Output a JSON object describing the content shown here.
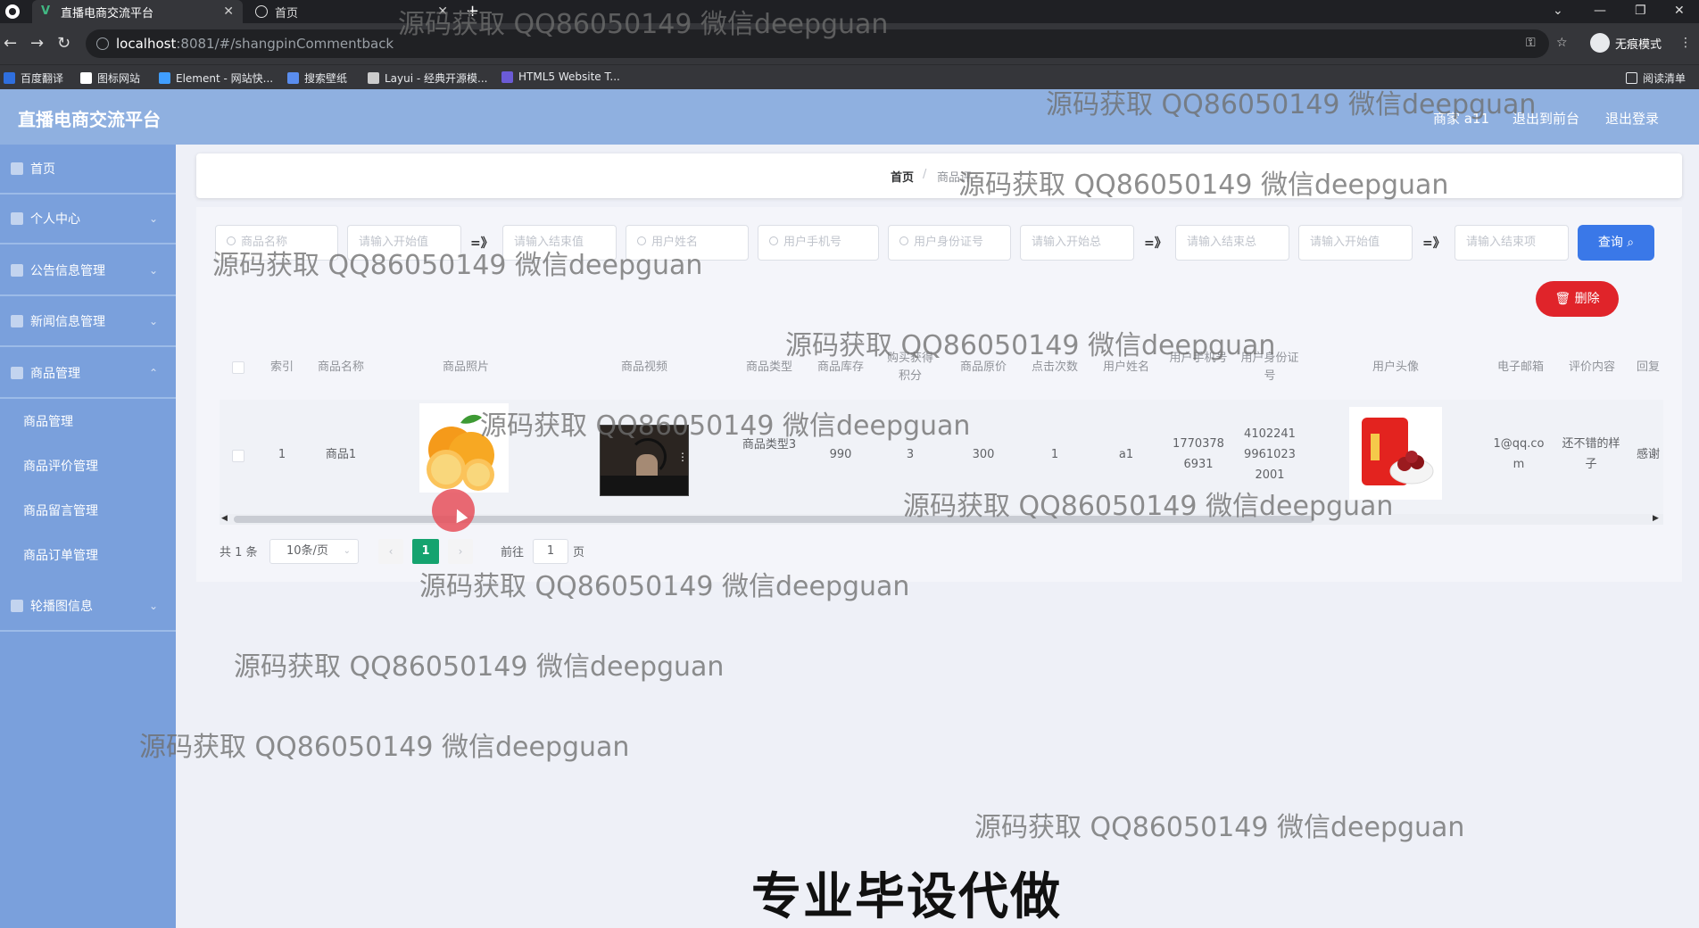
{
  "browser": {
    "tabs": [
      {
        "title": "直播电商交流平台",
        "active": true
      },
      {
        "title": "首页",
        "active": false
      }
    ],
    "url_host": "localhost",
    "url_path": ":8081/#/shangpinCommentback",
    "incognito_label": "无痕模式",
    "bookmarks": [
      "百度翻译",
      "图标网站",
      "Element - 网站快...",
      "搜索壁纸",
      "Layui - 经典开源模...",
      "HTML5 Website T..."
    ],
    "reading_list": "阅读清单"
  },
  "header": {
    "title": "直播电商交流平台",
    "user": "商家 a11",
    "back_front": "退出到前台",
    "logout": "退出登录"
  },
  "sidebar": {
    "items": [
      {
        "label": "首页"
      },
      {
        "label": "个人中心"
      },
      {
        "label": "公告信息管理"
      },
      {
        "label": "新闻信息管理"
      },
      {
        "label": "商品管理"
      }
    ],
    "sub_items": [
      {
        "label": "商品管理"
      },
      {
        "label": "商品评价管理"
      },
      {
        "label": "商品留言管理"
      },
      {
        "label": "商品订单管理"
      }
    ],
    "last_item": "轮播图信息"
  },
  "breadcrumb": {
    "home": "首页",
    "sep": "/",
    "current": "商品评"
  },
  "filters": {
    "placeholders": [
      "商品名称",
      "请输入开始值",
      "请输入结束值",
      "用户姓名",
      "用户手机号",
      "用户身份证号",
      "请输入开始总",
      "请输入结束总",
      "请输入开始值",
      "请输入结束项"
    ],
    "range_arrow": "=》",
    "query_label": "查询",
    "delete_label": "删除"
  },
  "table": {
    "headers": [
      "索引",
      "商品名称",
      "商品照片",
      "商品视频",
      "商品类型",
      "商品库存",
      "购买获得积分",
      "商品原价",
      "点击次数",
      "用户姓名",
      "用户手机号",
      "用户身份证号",
      "用户头像",
      "电子邮箱",
      "评价内容",
      "回复"
    ],
    "rows": [
      {
        "index": "1",
        "name": "商品1",
        "type": "商品类型3",
        "stock": "990",
        "points": "3",
        "price": "300",
        "clicks": "1",
        "user_name": "a1",
        "phone": "17703786931",
        "id_card": "410224199610232001",
        "email": "1@qq.com",
        "comment": "还不错的样子",
        "reply": "感谢"
      }
    ]
  },
  "pagination": {
    "total": "共 1 条",
    "page_size": "10条/页",
    "current_page": "1",
    "goto_label": "前往",
    "goto_value": "1",
    "page_unit": "页"
  },
  "watermark_text": "源码获取 QQ86050149 微信deepguan",
  "caption": "专业毕设代做",
  "colors": {
    "header_bg": "#8fb0e0",
    "sidebar_bg": "#7aa0dc",
    "query_btn": "#3a78e8",
    "delete_btn": "#e0242a",
    "page_active": "#15a36f"
  }
}
